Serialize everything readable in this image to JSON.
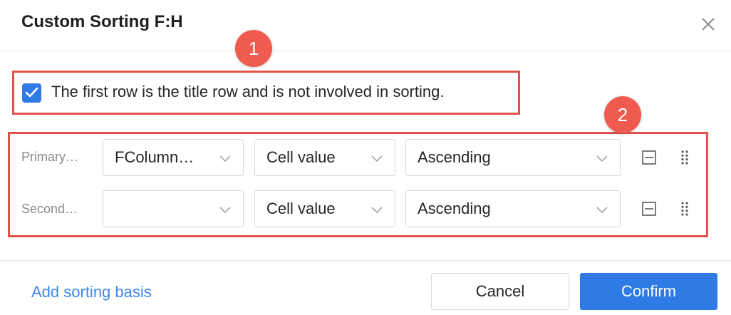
{
  "dialog": {
    "title": "Custom Sorting F:H",
    "close_icon": "close-icon"
  },
  "annotations": {
    "badge_1": "1",
    "badge_2": "2",
    "highlight_color": "#e0534a"
  },
  "options": {
    "first_row_title": {
      "checked": true,
      "label": "The first row is the title row and is not involved in sorting."
    }
  },
  "sort_rules": [
    {
      "label": "Primary…",
      "column": "FColumn…",
      "sort_on": "Cell value",
      "order": "Ascending"
    },
    {
      "label": "Second…",
      "column": "",
      "sort_on": "Cell value",
      "order": "Ascending"
    }
  ],
  "footer": {
    "add_link": "Add sorting basis",
    "cancel_label": "Cancel",
    "confirm_label": "Confirm"
  },
  "colors": {
    "accent": "#2f7be6",
    "link": "#3d86f0",
    "badge": "#f05b4f"
  }
}
